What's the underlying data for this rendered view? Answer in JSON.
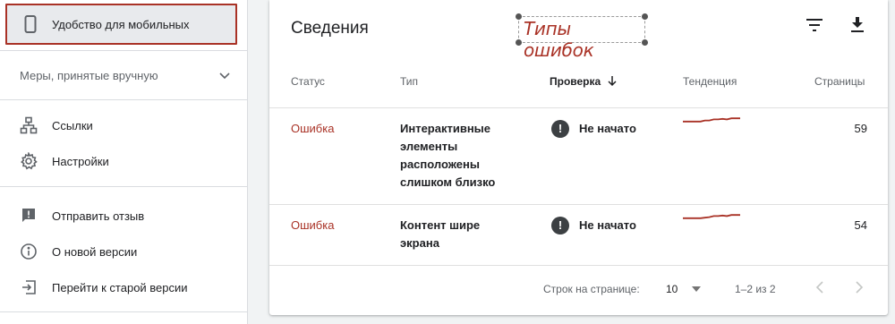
{
  "sidebar": {
    "active_item": {
      "label": "Удобство для мобильных",
      "icon": "phone-icon"
    },
    "section": {
      "label": "Меры, принятые вручную",
      "icon": "chevron-down-icon"
    },
    "items": [
      {
        "label": "Ссылки",
        "icon": "links-tree-icon"
      },
      {
        "label": "Настройки",
        "icon": "gear-icon"
      },
      {
        "label": "Отправить отзыв",
        "icon": "feedback-icon"
      },
      {
        "label": "О новой версии",
        "icon": "info-icon"
      },
      {
        "label": "Перейти к старой версии",
        "icon": "exit-icon"
      }
    ]
  },
  "card": {
    "title": "Сведения",
    "annotation": "Типы ошибок",
    "tools": {
      "filter_icon": "filter-icon",
      "download_icon": "download-icon"
    },
    "columns": [
      "Статус",
      "Тип",
      "Проверка",
      "Тенденция",
      "Страницы"
    ],
    "sort_icon": "arrow-down-icon",
    "rows": [
      {
        "status": "Ошибка",
        "type": "Интерактивные элементы расположены слишком близко",
        "check": "Не начато",
        "check_icon": "warning-circle-icon",
        "trend": [
          4,
          4,
          4,
          4,
          4,
          3,
          3,
          2,
          2,
          1.5,
          2,
          1,
          1,
          1
        ],
        "pages": "59"
      },
      {
        "status": "Ошибка",
        "type": "Контент шире экрана",
        "check": "Не начато",
        "check_icon": "warning-circle-icon",
        "trend": [
          4,
          4,
          4,
          4,
          4,
          3.5,
          3,
          2,
          2,
          1.5,
          2,
          1,
          1,
          1
        ],
        "pages": "54"
      }
    ],
    "footer": {
      "rows_per_page_label": "Строк на странице:",
      "rows_per_page_value": "10",
      "range": "1–2 из 2",
      "prev_icon": "chevron-left-icon",
      "next_icon": "chevron-right-icon"
    }
  },
  "colors": {
    "accent": "#a93226",
    "text": "#202124",
    "muted": "#5f6368"
  }
}
